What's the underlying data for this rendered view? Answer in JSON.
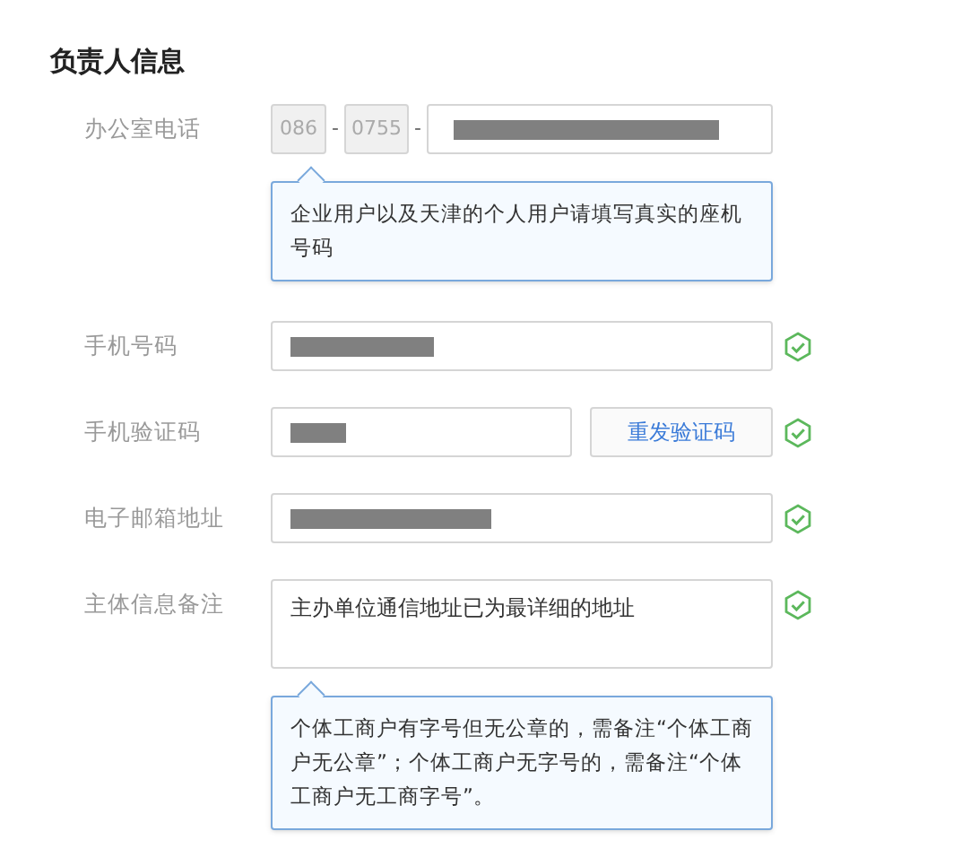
{
  "section_title": "负责人信息",
  "fields": [
    {
      "kind": "phone",
      "label": "办公室电话",
      "country_code": "086",
      "area_code": "0755",
      "separators": [
        "-",
        "-"
      ],
      "redacted": true,
      "valid": false,
      "tooltip": "企业用户以及天津的个人用户请填写真实的座机号码"
    },
    {
      "kind": "text",
      "label": "手机号码",
      "redacted": true,
      "valid": true
    },
    {
      "kind": "code",
      "label": "手机验证码",
      "redacted": true,
      "button": "重发验证码",
      "valid": true
    },
    {
      "kind": "text",
      "label": "电子邮箱地址",
      "redacted": true,
      "valid": true
    },
    {
      "kind": "textarea",
      "label": "主体信息备注",
      "value": "主办单位通信地址已为最详细的地址",
      "valid": true,
      "tooltip": "个体工商户有字号但无公章的，需备注“个体工商户无公章”；个体工商户无字号的，需备注“个体工商户无工商字号”。"
    }
  ]
}
